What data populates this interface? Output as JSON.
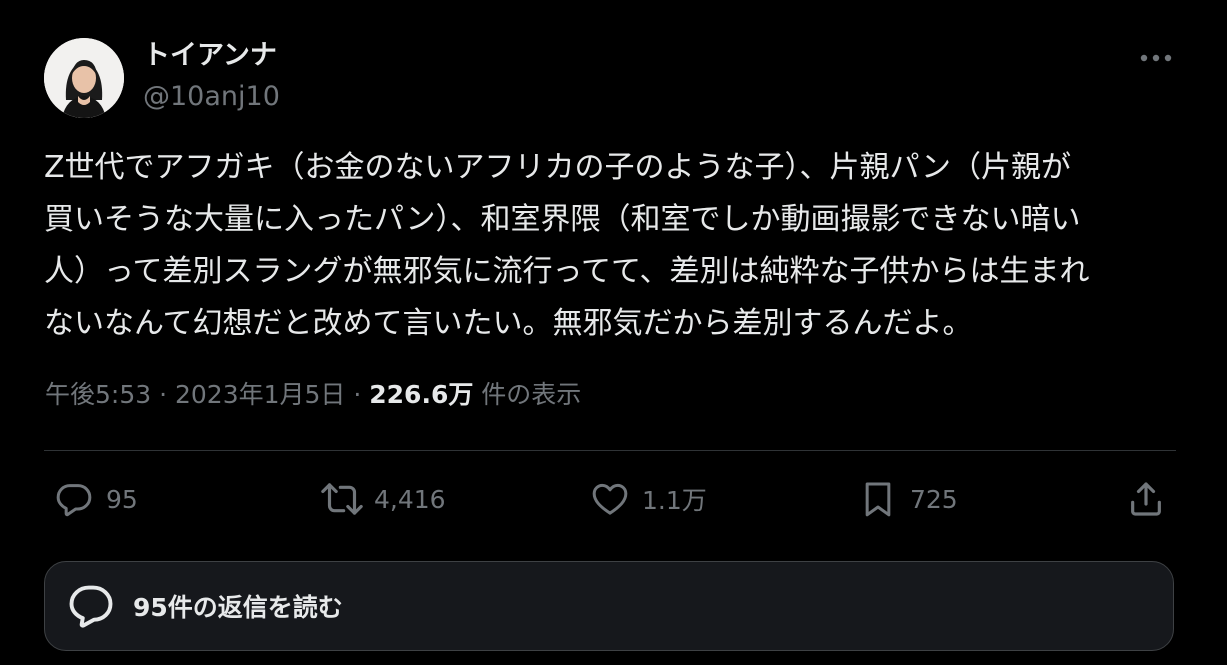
{
  "author": {
    "display_name": "トイアンナ",
    "handle": "@10anj10"
  },
  "tweet": {
    "text": "Z世代でアフガキ（お金のないアフリカの子のような子）、片親パン（片親が\n買いそうな大量に入ったパン）、和室界隈（和室でしか動画撮影できない暗い\n人）って差別スラングが無邪気に流行ってて、差別は純粋な子供からは生まれ\nないなんて幻想だと改めて言いたい。無邪気だから差別するんだよ。",
    "time": "午後5:53",
    "separator1": " · ",
    "date": "2023年1月5日",
    "separator2": " · ",
    "views_count": "226.6万",
    "views_label": " 件の表示"
  },
  "actions": {
    "replies": "95",
    "reposts": "4,416",
    "likes": "1.1万",
    "bookmarks": "725"
  },
  "read_replies_label": "95件の返信を読む",
  "icons": {
    "more": "more-horizontal-icon",
    "reply": "reply-icon",
    "repost": "repost-icon",
    "like": "heart-icon",
    "bookmark": "bookmark-icon",
    "share": "share-icon",
    "read_replies": "speech-bubble-icon"
  },
  "colors": {
    "background": "#000000",
    "text_primary": "#e7e9ea",
    "text_secondary": "#71767b",
    "divider": "#2f3336",
    "card": "#16181c"
  }
}
